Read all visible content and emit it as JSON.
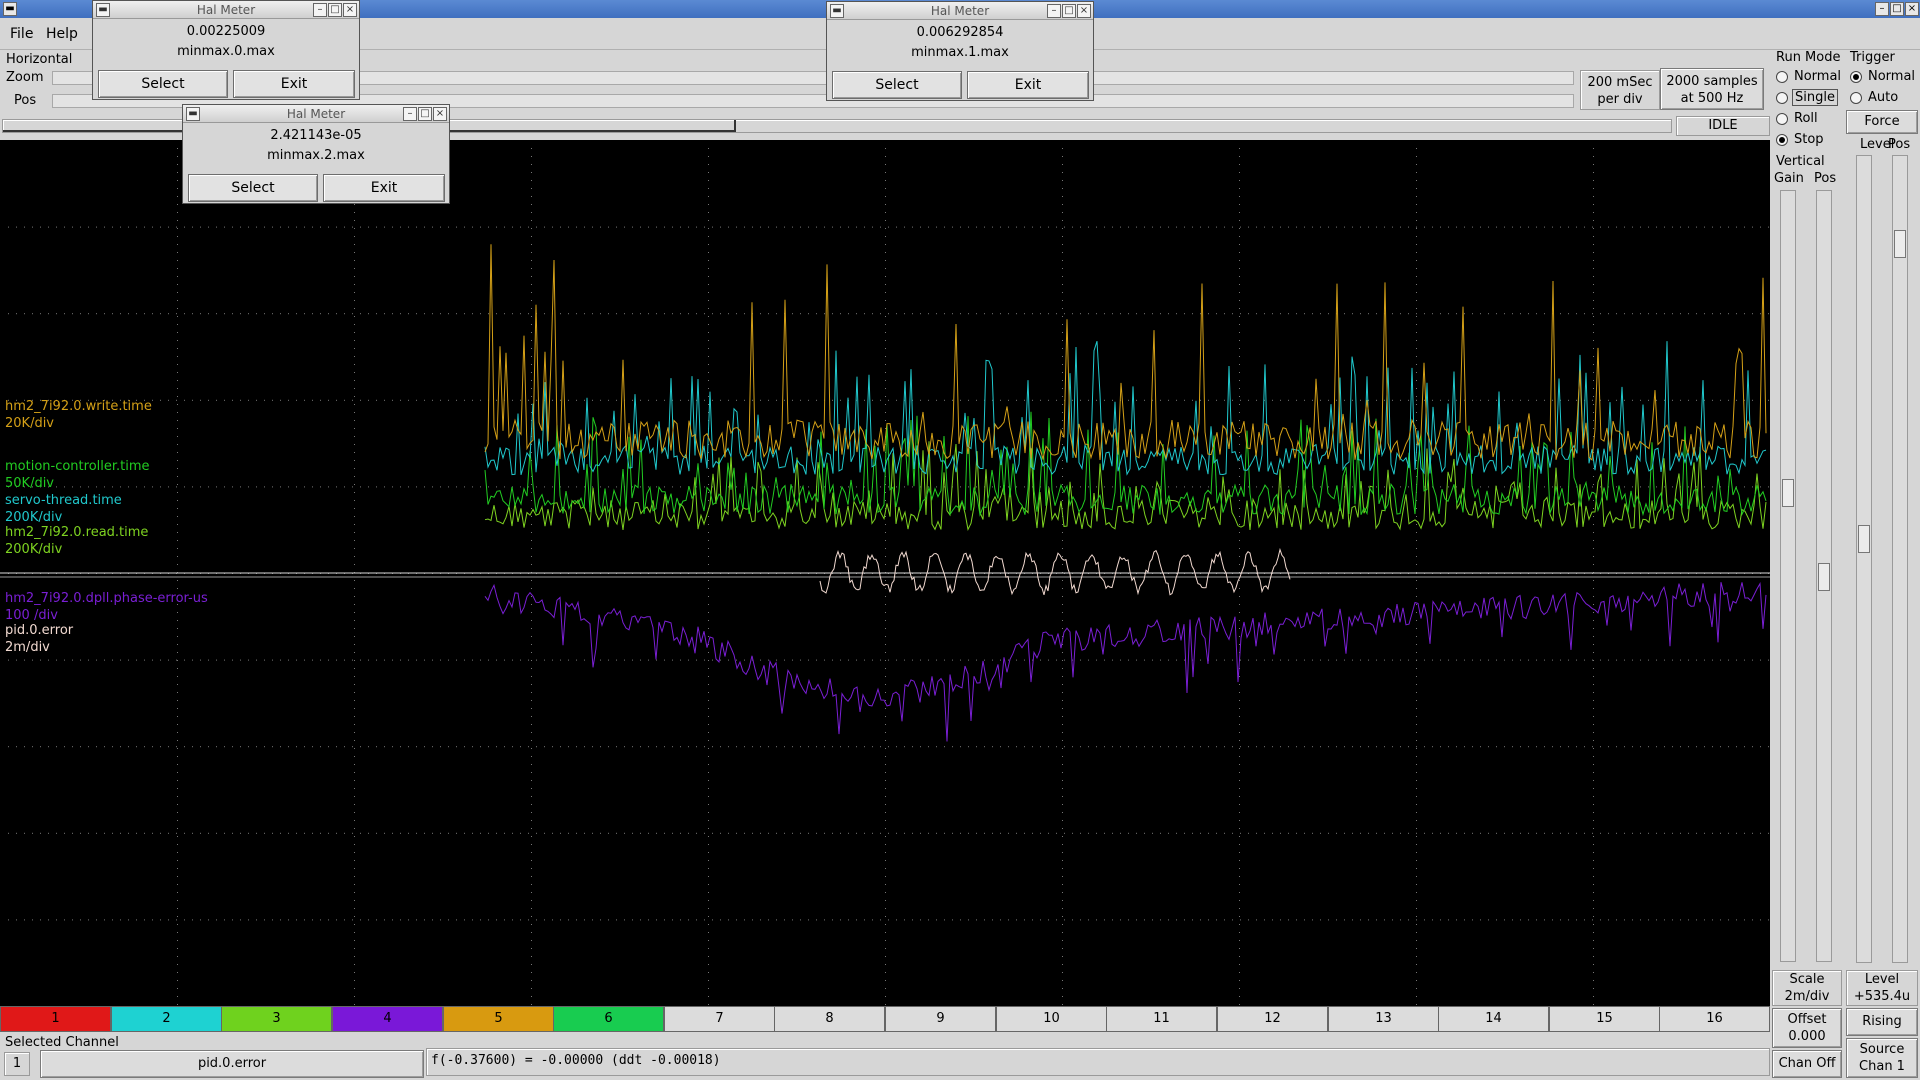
{
  "menu": {
    "file": "File",
    "help": "Help"
  },
  "horizontal": {
    "group_label": "Horizontal",
    "zoom_label": "Zoom",
    "pos_label": "Pos",
    "rate_line1": "200 mSec",
    "rate_line2": "per div",
    "samples_line1": "2000 samples",
    "samples_line2": "at 500 Hz",
    "status": "IDLE"
  },
  "run_mode": {
    "label": "Run Mode",
    "options": [
      "Normal",
      "Single",
      "Roll",
      "Stop"
    ],
    "selected": "Stop"
  },
  "trigger": {
    "label": "Trigger",
    "options": [
      "Normal",
      "Auto"
    ],
    "selected": "Normal",
    "force_label": "Force",
    "level_label": "Level",
    "pos_label": "Pos",
    "level_value_label": "Level",
    "level_value": "+535.4u",
    "edge": "Rising",
    "source_label": "Source",
    "source_value": "Chan  1"
  },
  "vertical": {
    "label": "Vertical",
    "gain_label": "Gain",
    "pos_label": "Pos",
    "scale_label": "Scale",
    "scale_value": "2m/div",
    "offset_label": "Offset",
    "offset_value": "0.000",
    "chan_off_label": "Chan Off"
  },
  "traces": [
    {
      "name": "hm2_7i92.0.write.time",
      "scale": "20K/div",
      "color": "#d4a017"
    },
    {
      "name": "motion-controller.time",
      "scale": "50K/div",
      "color": "#22cc22"
    },
    {
      "name": "servo-thread.time",
      "scale": "200K/div",
      "color": "#20c8cc"
    },
    {
      "name": "hm2_7i92.0.read.time",
      "scale": "200K/div",
      "color": "#7ed321"
    },
    {
      "name": "hm2_7i92.0.dpll.phase-error-us",
      "scale": "100 /div",
      "color": "#7a1fd4"
    },
    {
      "name": "pid.0.error",
      "scale": "2m/div",
      "color": "#f1d9d0"
    }
  ],
  "channels": [
    "1",
    "2",
    "3",
    "4",
    "5",
    "6",
    "7",
    "8",
    "9",
    "10",
    "11",
    "12",
    "13",
    "14",
    "15",
    "16"
  ],
  "channel_colors": [
    "#e01818",
    "#1ed2d2",
    "#6fd21e",
    "#7a18d8",
    "#d89a10",
    "#18cc50"
  ],
  "selected_channel": {
    "label": "Selected Channel",
    "number": "1",
    "name": "pid.0.error",
    "readout": "f(-0.37600) = -0.00000 (ddt -0.00018)"
  },
  "hal_meters": [
    {
      "title": "Hal Meter",
      "value": "0.00225009",
      "pin": "minmax.0.max",
      "select": "Select",
      "exit": "Exit"
    },
    {
      "title": "Hal Meter",
      "value": "0.006292854",
      "pin": "minmax.1.max",
      "select": "Select",
      "exit": "Exit"
    },
    {
      "title": "Hal Meter",
      "value": "2.421143e-05",
      "pin": "minmax.2.max",
      "select": "Select",
      "exit": "Exit"
    }
  ]
}
